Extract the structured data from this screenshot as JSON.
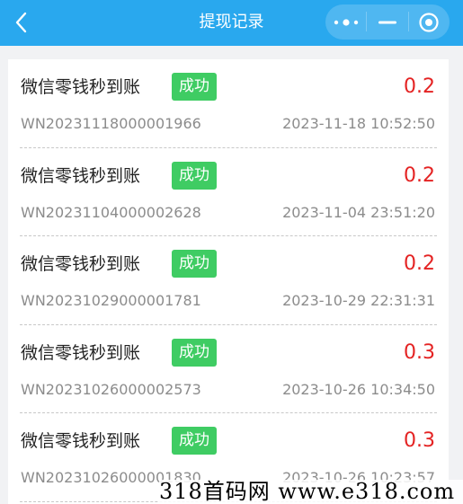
{
  "header": {
    "title": "提现记录",
    "background": "#29a8ee"
  },
  "records": [
    {
      "name": "微信零钱秒到账",
      "status": "成功",
      "amount": "0.2",
      "order_no": "WN20231118000001966",
      "time": "2023-11-18 10:52:50"
    },
    {
      "name": "微信零钱秒到账",
      "status": "成功",
      "amount": "0.2",
      "order_no": "WN20231104000002628",
      "time": "2023-11-04 23:51:20"
    },
    {
      "name": "微信零钱秒到账",
      "status": "成功",
      "amount": "0.2",
      "order_no": "WN20231029000001781",
      "time": "2023-10-29 22:31:31"
    },
    {
      "name": "微信零钱秒到账",
      "status": "成功",
      "amount": "0.3",
      "order_no": "WN20231026000002573",
      "time": "2023-10-26 10:34:50"
    },
    {
      "name": "微信零钱秒到账",
      "status": "成功",
      "amount": "0.3",
      "order_no": "WN20231026000001830",
      "time": "2023-10-26 10:23:57"
    }
  ],
  "watermark": "318首码网  www.e318.com",
  "colors": {
    "status_badge": "#3fcc63",
    "amount": "#e42323"
  },
  "icons": [
    "back-arrow-icon",
    "more-dots-icon",
    "minimize-icon",
    "close-target-icon"
  ]
}
